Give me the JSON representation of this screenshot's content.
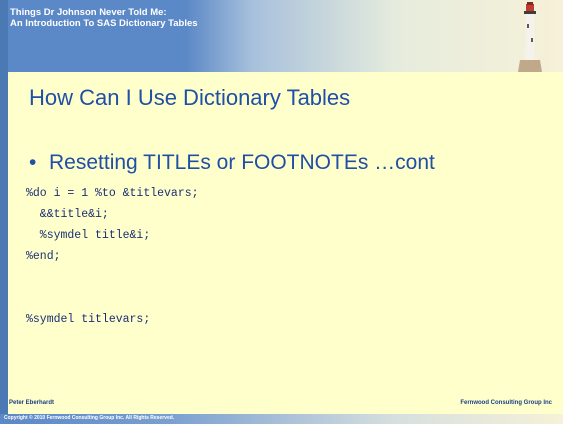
{
  "header": {
    "title_line1": "Things Dr Johnson Never Told Me:",
    "title_line2": "An Introduction To SAS Dictionary Tables"
  },
  "slide": {
    "heading": "How Can I Use Dictionary Tables",
    "bullet_marker": "•",
    "bullet_text": "Resetting TITLEs or FOOTNOTEs …cont",
    "code_lines": [
      "%do i = 1 %to &titlevars;",
      "  &&title&i;",
      "  %symdel title&i;",
      "%end;",
      "",
      "",
      "%symdel titlevars;"
    ]
  },
  "footer": {
    "author": "Peter Eberhardt",
    "company": "Fernwood Consulting Group Inc",
    "copyright": "Copyright © 2010 Fernwood Consulting Group Inc. All Rights Reserved."
  },
  "colors": {
    "background": "#ffffcc",
    "heading": "#1f4fa6",
    "code": "#1a2f73",
    "header_blue": "#5b88c6"
  },
  "icons": {
    "header_image": "lighthouse-icon"
  }
}
